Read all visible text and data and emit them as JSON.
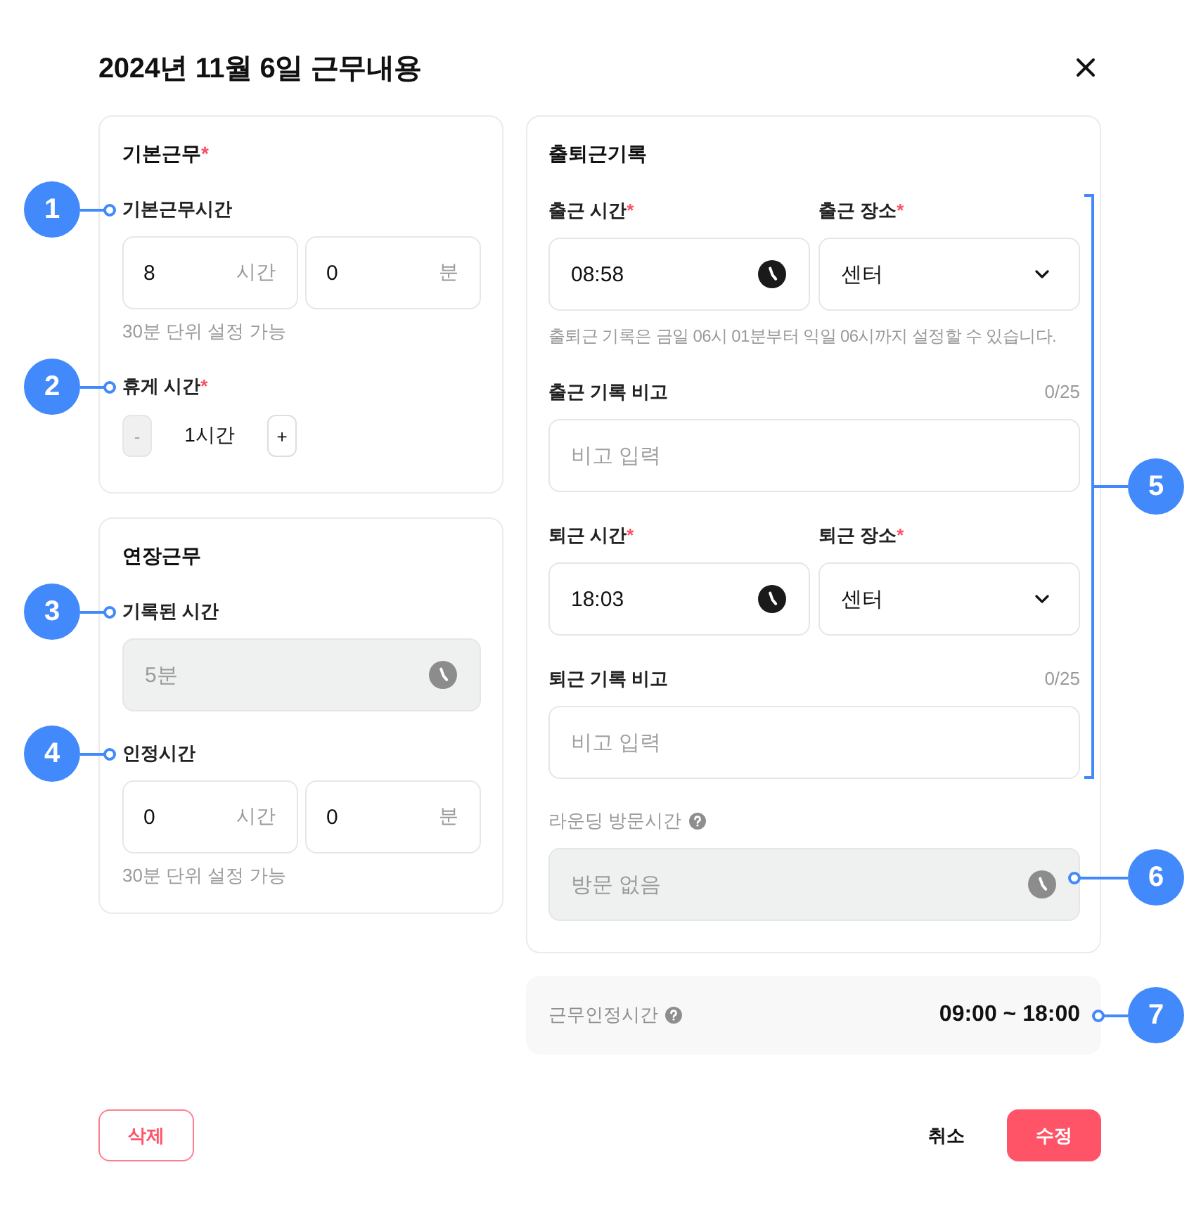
{
  "dialog": {
    "title": "2024년 11월 6일 근무내용"
  },
  "left_cards": [
    {
      "heading": "기본근무",
      "mark": "*",
      "fields": [
        {
          "kind": "duration",
          "label": "기본근무시간",
          "callout": "1",
          "parts": [
            {
              "value": "8",
              "unit": "시간"
            },
            {
              "value": "0",
              "unit": "분"
            }
          ],
          "help": "30분 단위 설정 가능"
        },
        {
          "kind": "stepper",
          "label": "휴게 시간",
          "mark": "*",
          "callout": "2",
          "value": "1시간",
          "minus": {
            "label": "-",
            "disabled": true
          },
          "plus": {
            "label": "+",
            "disabled": false
          }
        }
      ]
    },
    {
      "heading": "연장근무",
      "fields": [
        {
          "kind": "readonly",
          "label": "기록된 시간",
          "callout": "3",
          "value": "5분",
          "disabled": true
        },
        {
          "kind": "duration",
          "label": "인정시간",
          "callout": "4",
          "parts": [
            {
              "value": "0",
              "unit": "시간"
            },
            {
              "value": "0",
              "unit": "분"
            }
          ],
          "help": "30분 단위 설정 가능"
        }
      ]
    }
  ],
  "attendance": {
    "heading": "출퇴근기록",
    "records": {
      "callout": "5",
      "groups": [
        {
          "time": {
            "label": "출근 시간",
            "mark": "*",
            "value": "08:58"
          },
          "place": {
            "label": "출근 장소",
            "mark": "*",
            "value": "센터"
          },
          "hint": "출퇴근 기록은 금일 06시 01분부터 익일 06시까지 설정할 수 있습니다.",
          "memo": {
            "label": "출근 기록 비고",
            "counter": "0/25",
            "placeholder": "비고 입력"
          }
        },
        {
          "time": {
            "label": "퇴근 시간",
            "mark": "*",
            "value": "18:03"
          },
          "place": {
            "label": "퇴근 장소",
            "mark": "*",
            "value": "센터"
          },
          "memo": {
            "label": "퇴근 기록 비고",
            "counter": "0/25",
            "placeholder": "비고 입력"
          }
        }
      ]
    },
    "rounding": {
      "label": "라운딩 방문시간",
      "value": "방문 없음",
      "disabled": true,
      "callout": "6"
    }
  },
  "summary": {
    "label": "근무인정시간",
    "value": "09:00 ~ 18:00",
    "callout": "7"
  },
  "footer": {
    "left": [
      {
        "label": "삭제",
        "kind": "danger-outline"
      }
    ],
    "right": [
      {
        "label": "취소",
        "kind": "text"
      },
      {
        "label": "수정",
        "kind": "primary"
      }
    ]
  }
}
